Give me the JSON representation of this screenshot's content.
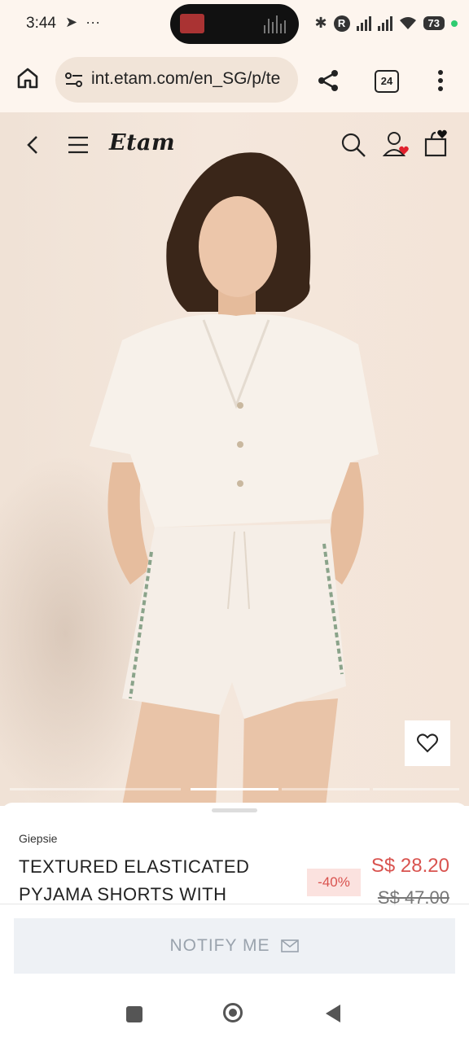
{
  "status_bar": {
    "time": "3:44",
    "telegram_icon": "telegram-icon",
    "more": "···",
    "battery": "73",
    "r_badge": "R"
  },
  "browser": {
    "url": "int.etam.com/en_SG/p/te",
    "tab_count": "24"
  },
  "site": {
    "logo": "Etam"
  },
  "gallery": {
    "slide_count": 5,
    "active_slide": 3
  },
  "product": {
    "brand": "Giepsie",
    "name": "TEXTURED ELASTICATED PYJAMA SHORTS WITH",
    "discount": "-40%",
    "price": "S$ 28.20",
    "original_price": "S$ 47.00"
  },
  "cta": {
    "notify_label": "NOTIFY ME"
  },
  "colors": {
    "accent": "#d9534f",
    "hero_bg": "#f3e4d8"
  }
}
